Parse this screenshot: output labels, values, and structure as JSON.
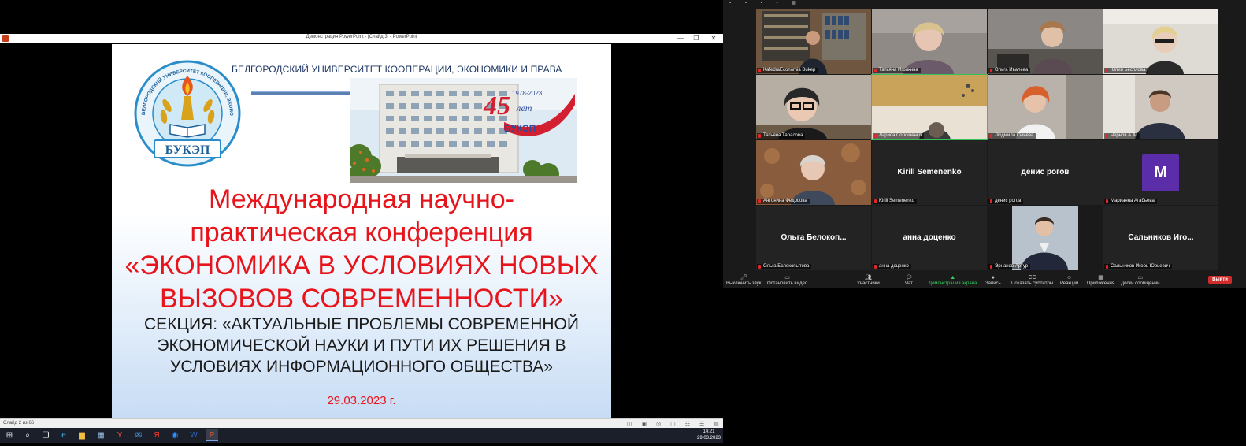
{
  "ppt": {
    "window_title": "Демонстрация PowerPoint - [Слайд 3] - PowerPoint",
    "win_min": "—",
    "win_max": "❐",
    "win_close": "✕",
    "status_slide": "Слайд 2 из 66",
    "view_icons": "◫ ▣ ◎ ◫ ☷ ☰ ▤"
  },
  "slide": {
    "logo_text_top": "БЕЛГОРОДСКИЙ УНИВЕРСИТЕТ КООПЕРАЦИИ, ЭКОНОМИКИ И ПРАВА",
    "logo_badge": "БУКЭП",
    "university_name": "БЕЛГОРОДСКИЙ УНИВЕРСИТЕТ КООПЕРАЦИИ, ЭКОНОМИКИ И ПРАВА",
    "anniversary_number": "45",
    "anniversary_word": "лет",
    "anniversary_years": "1978-2023",
    "anniversary_badge": "БУКЭП",
    "title_lines": [
      "Международная научно-",
      "практическая конференция",
      "«ЭКОНОМИКА В УСЛОВИЯХ НОВЫХ",
      "ВЫЗОВОВ СОВРЕМЕННОСТИ»"
    ],
    "section_lines": [
      "СЕКЦИЯ: «АКТУАЛЬНЫЕ ПРОБЛЕМЫ СОВРЕМЕННОЙ",
      "ЭКОНОМИЧЕСКОЙ НАУКИ И ПУТИ ИХ РЕШЕНИЯ В",
      "УСЛОВИЯХ ИНФОРМАЦИОННОГО ОБЩЕСТВА»"
    ],
    "date": "29.03.2023 г."
  },
  "taskbar": {
    "icons": [
      "windows-logo",
      "search",
      "task-view",
      "edge",
      "file-explorer",
      "store",
      "yandex-browser",
      "mail",
      "yandex",
      "zoom",
      "word",
      "powerpoint"
    ],
    "glyphs": [
      "⊞",
      "⌕",
      "❏",
      "e",
      "▆",
      "▦",
      "Y",
      "✉",
      "Я",
      "◉",
      "W",
      "P"
    ],
    "time": "14:21",
    "date": "29.03.2023"
  },
  "zoom": {
    "top_icons": "▪ ▪ ▪ ▪ ▦",
    "participants": [
      {
        "name": "KafedraEconomia Bukep",
        "kind": "video",
        "tone": "office"
      },
      {
        "name": "Татьяна Иголкина",
        "kind": "video",
        "tone": "blonde"
      },
      {
        "name": "Ольга Ивалева",
        "kind": "video",
        "tone": "desk"
      },
      {
        "name": "Юлия Бесплова",
        "kind": "video",
        "tone": "light"
      },
      {
        "name": "Татьяна Тарасова",
        "kind": "video",
        "tone": "glasses"
      },
      {
        "name": "Лариса Солошенко",
        "kind": "video",
        "tone": "ceiling",
        "speaking": true
      },
      {
        "name": "Людмила Сычева",
        "kind": "video",
        "tone": "red"
      },
      {
        "name": "Чернов А.А.",
        "kind": "video",
        "tone": "man"
      },
      {
        "name": "Антонина Федосова",
        "kind": "video",
        "tone": "rug"
      },
      {
        "name": "Kirill Semenenko",
        "kind": "name",
        "display": "Kirill Semenenko"
      },
      {
        "name": "денис рогов",
        "kind": "name",
        "display": "денис рогов"
      },
      {
        "name": "Марианна Агабьева",
        "kind": "avatar",
        "letter": "M"
      },
      {
        "name": "Ольга Белокопытова",
        "kind": "name",
        "display": "Ольга  Белокоп..."
      },
      {
        "name": "анна доценко",
        "kind": "name",
        "display": "анна доценко"
      },
      {
        "name": "Эрнанов Артур",
        "kind": "video",
        "tone": "suit"
      },
      {
        "name": "Сальников Игорь Юрьевич",
        "kind": "name",
        "display": "Сальников  Иго..."
      }
    ],
    "toolbar": [
      {
        "label": "Выключить звук",
        "icon": "🎤︎"
      },
      {
        "label": "Остановить видео",
        "icon": "▭"
      },
      {
        "label": "Участники",
        "icon": "👥︎"
      },
      {
        "label": "Чат",
        "icon": "💬︎"
      },
      {
        "label": "Демонстрация экрана",
        "icon": "▲",
        "share": true
      },
      {
        "label": "Запись",
        "icon": "●"
      },
      {
        "label": "Показать субтитры",
        "icon": "CC"
      },
      {
        "label": "Реакции",
        "icon": "☺"
      },
      {
        "label": "Приложения",
        "icon": "▦"
      },
      {
        "label": "Доски сообщений",
        "icon": "▭"
      }
    ],
    "leave": "Выйти"
  }
}
